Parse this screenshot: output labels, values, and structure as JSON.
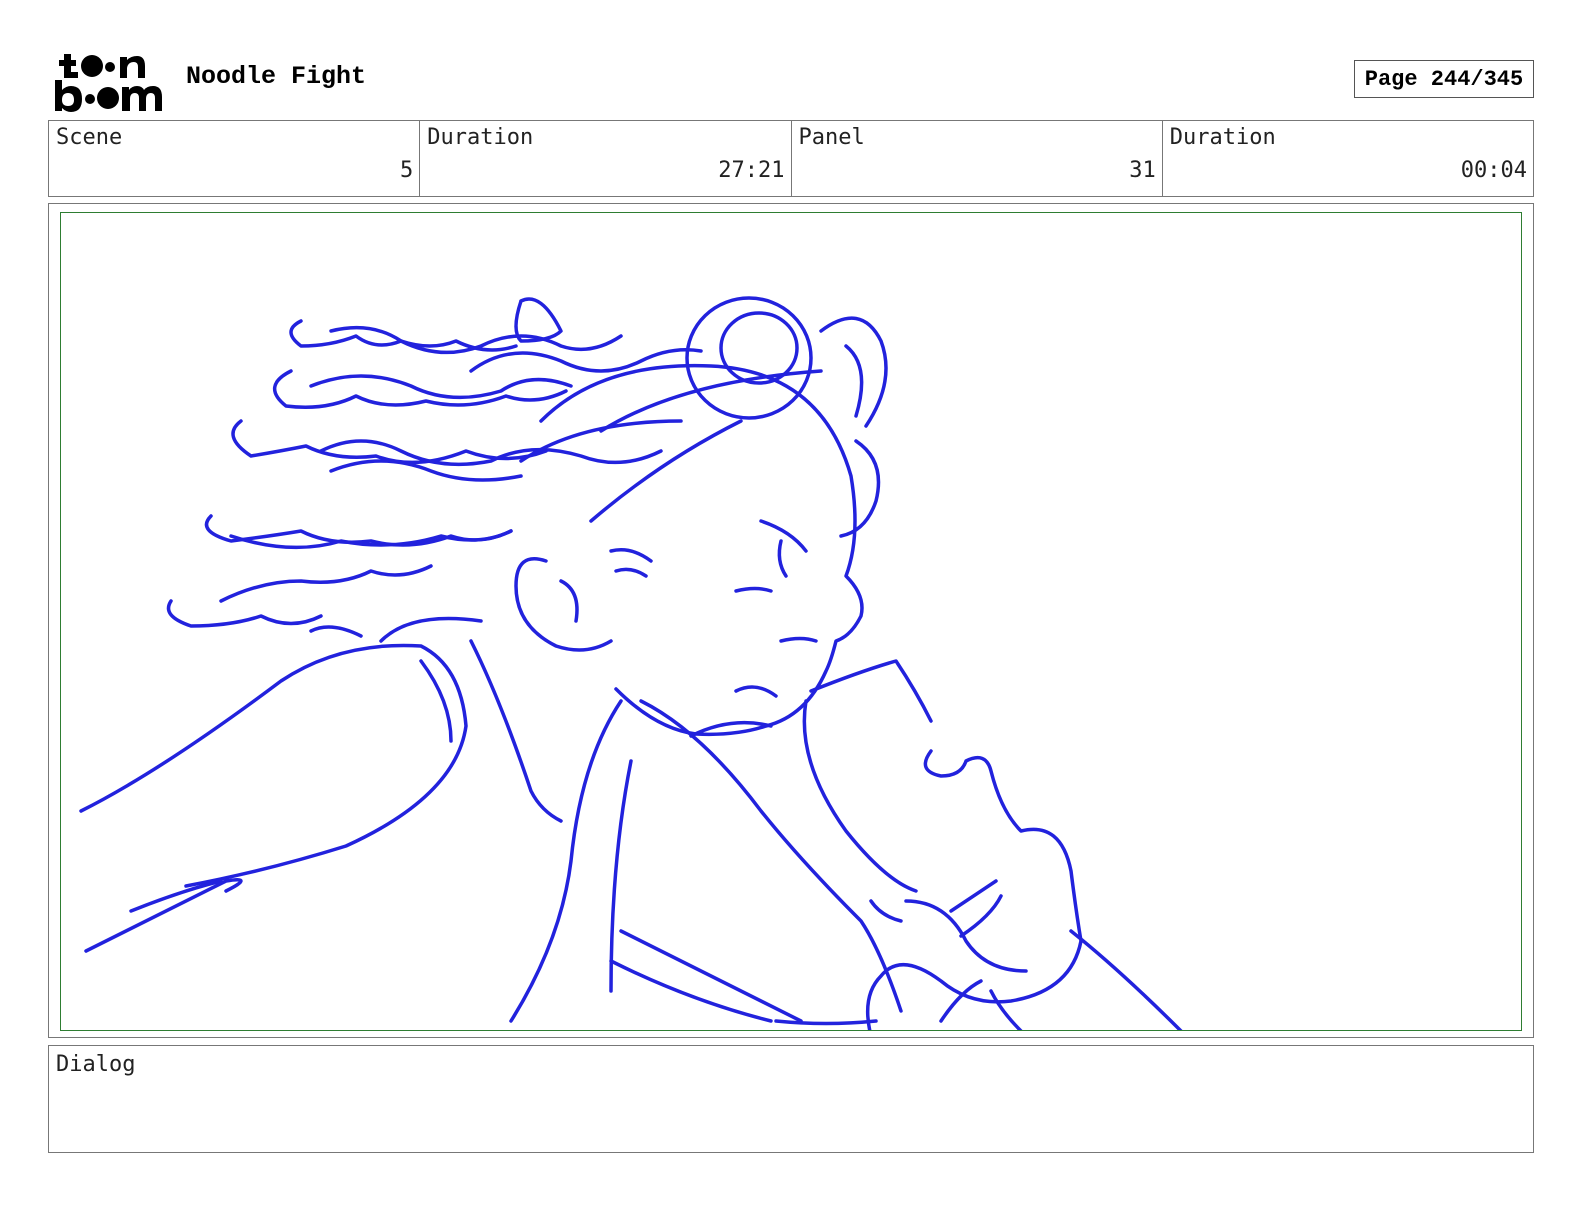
{
  "header": {
    "logo_icon": "toon-boom-logo-icon",
    "logo_text": "toon boom",
    "project_title": "Noodle Fight",
    "page_label": "Page 244/345"
  },
  "info": [
    {
      "label": "Scene",
      "value": "5"
    },
    {
      "label": "Duration",
      "value": "27:21"
    },
    {
      "label": "Panel",
      "value": "31"
    },
    {
      "label": "Duration",
      "value": "00:04"
    }
  ],
  "panel": {
    "sketch_color": "#2222dd",
    "safe_area_color": "#2e7d32"
  },
  "dialog": {
    "label": "Dialog",
    "text": ""
  }
}
